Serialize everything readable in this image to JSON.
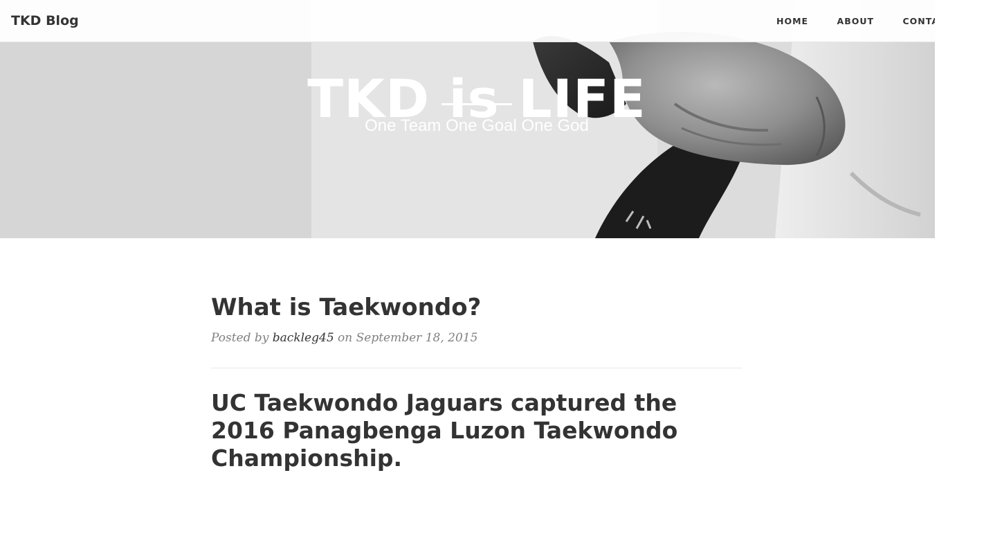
{
  "navbar": {
    "brand": "TKD Blog",
    "links": [
      "HOME",
      "ABOUT",
      "CONTACT"
    ]
  },
  "hero": {
    "title": "TKD is LIFE",
    "subtitle": "One Team One Goal One God"
  },
  "post": {
    "title": "What is Taekwondo?",
    "meta_prefix": "Posted by ",
    "author": "backleg45",
    "meta_on": " on ",
    "date": "September 18, 2015",
    "headline": "UC Taekwondo Jaguars captured the 2016 Panagbenga Luzon Taekwondo Championship."
  },
  "colors": {
    "text": "#333333",
    "meta": "#808080",
    "divider": "#e8e8e8"
  }
}
